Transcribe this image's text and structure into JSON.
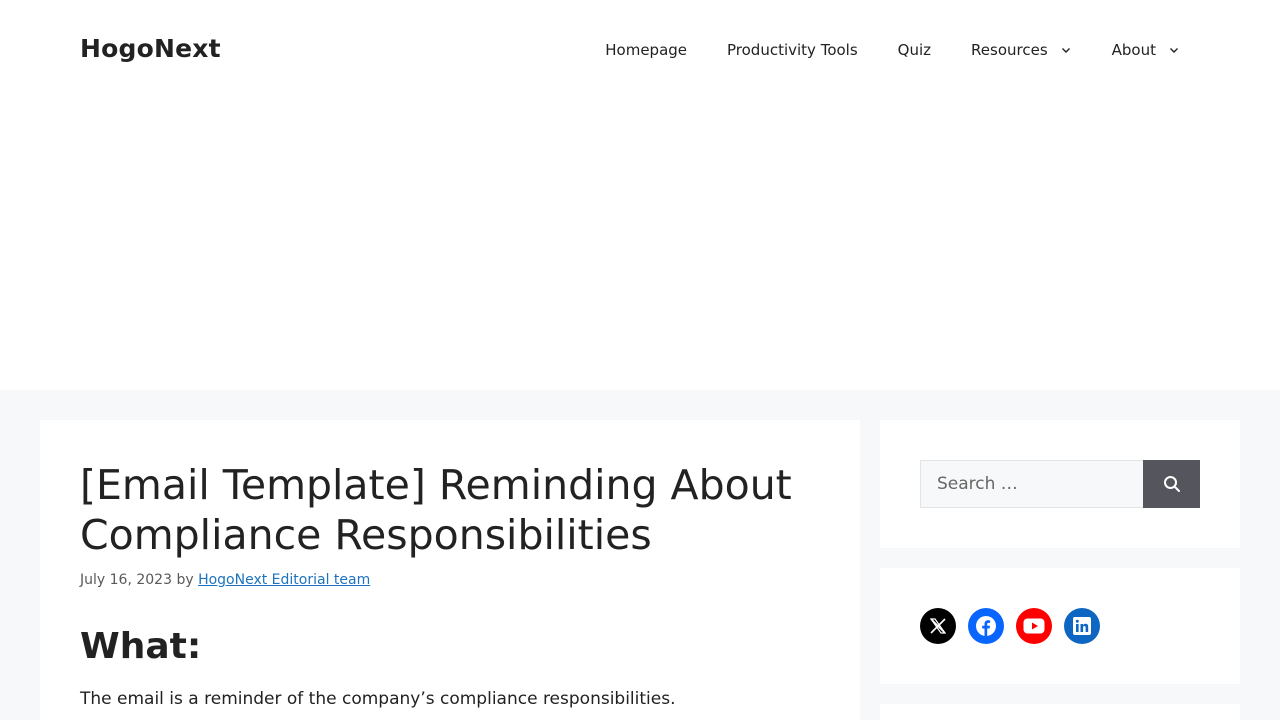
{
  "site": {
    "logo": "HogoNext"
  },
  "nav": {
    "items": [
      {
        "label": "Homepage",
        "has_dropdown": false
      },
      {
        "label": "Productivity Tools",
        "has_dropdown": false
      },
      {
        "label": "Quiz",
        "has_dropdown": false
      },
      {
        "label": "Resources",
        "has_dropdown": true
      },
      {
        "label": "About",
        "has_dropdown": true
      }
    ]
  },
  "post": {
    "title": "[Email Template] Reminding About Compliance Responsibilities",
    "date": "July 16, 2023",
    "by": "by",
    "author": "HogoNext Editorial team",
    "section_heading": "What:",
    "paragraph": "The email is a reminder of the company’s compliance responsibilities."
  },
  "search": {
    "placeholder": "Search …",
    "value": ""
  },
  "social": {
    "icons": [
      {
        "name": "x-icon",
        "color": "#000000"
      },
      {
        "name": "facebook-icon",
        "color": "#0866ff"
      },
      {
        "name": "youtube-icon",
        "color": "#ff0000"
      },
      {
        "name": "linkedin-icon",
        "color": "#0d66c2"
      }
    ]
  },
  "colors": {
    "page_bg": "#f7f8f9",
    "link": "#1e73be",
    "search_button": "#55555e"
  }
}
